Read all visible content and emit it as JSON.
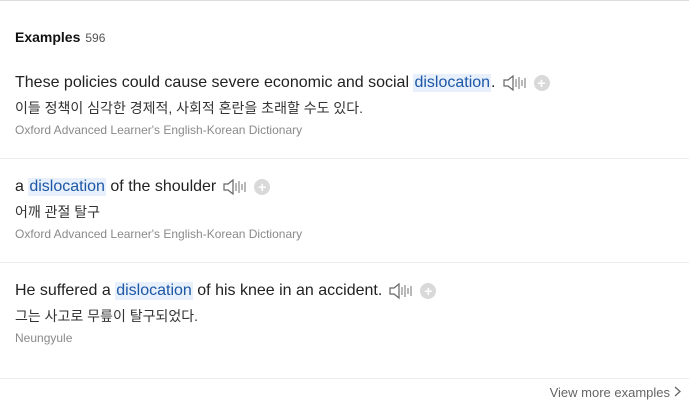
{
  "header": {
    "title": "Examples",
    "count": "596"
  },
  "examples": [
    {
      "before": "These policies could cause severe economic and social ",
      "highlight": "dislocation",
      "after": ".",
      "translation": "이들 정책이 심각한 경제적, 사회적 혼란을 초래할 수도 있다.",
      "source": "Oxford Advanced Learner's English-Korean Dictionary"
    },
    {
      "before": "a ",
      "highlight": "dislocation",
      "after": " of the shoulder",
      "translation": "어깨 관절 탈구",
      "source": "Oxford Advanced Learner's English-Korean Dictionary"
    },
    {
      "before": "He suffered a ",
      "highlight": "dislocation",
      "after": " of his knee in an accident.",
      "translation": "그는 사고로 무릎이 탈구되었다.",
      "source": "Neungyule"
    }
  ],
  "footer": {
    "view_more": "View more examples"
  },
  "icons": {
    "speaker": "speaker-icon",
    "add": "plus-icon",
    "chevron": "chevron-right-icon"
  },
  "colors": {
    "highlight_bg": "#e7f0fb",
    "highlight_text": "#1d57a6",
    "source_text": "#8a8a8a"
  }
}
